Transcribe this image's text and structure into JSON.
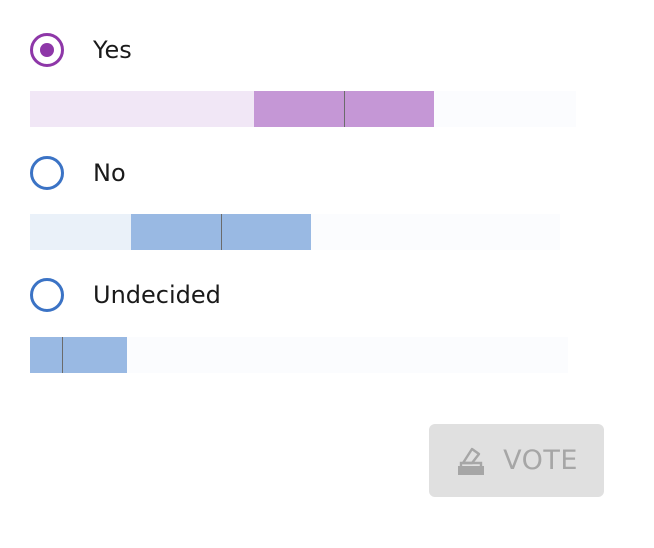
{
  "poll": {
    "options": [
      {
        "label": "Yes",
        "selected": true,
        "accent_color": "#8e37a8",
        "light_color": "#f1e7f6",
        "mid_color": "#c597d6",
        "value_range": [
          0.41,
          0.74
        ],
        "marker": 0.575
      },
      {
        "label": "No",
        "selected": false,
        "accent_color": "#3b73c5",
        "light_color": "#eaf1f9",
        "mid_color": "#99b9e3",
        "value_range": [
          0.19,
          0.53
        ],
        "marker": 0.36
      },
      {
        "label": "Undecided",
        "selected": false,
        "accent_color": "#3b73c5",
        "light_color": "#eaf1f9",
        "mid_color": "#99b9e3",
        "value_range": [
          0.0,
          0.18
        ],
        "marker": 0.06
      }
    ]
  },
  "vote_button": {
    "label": "VOTE",
    "icon": "ballot-box-icon",
    "disabled": true
  }
}
